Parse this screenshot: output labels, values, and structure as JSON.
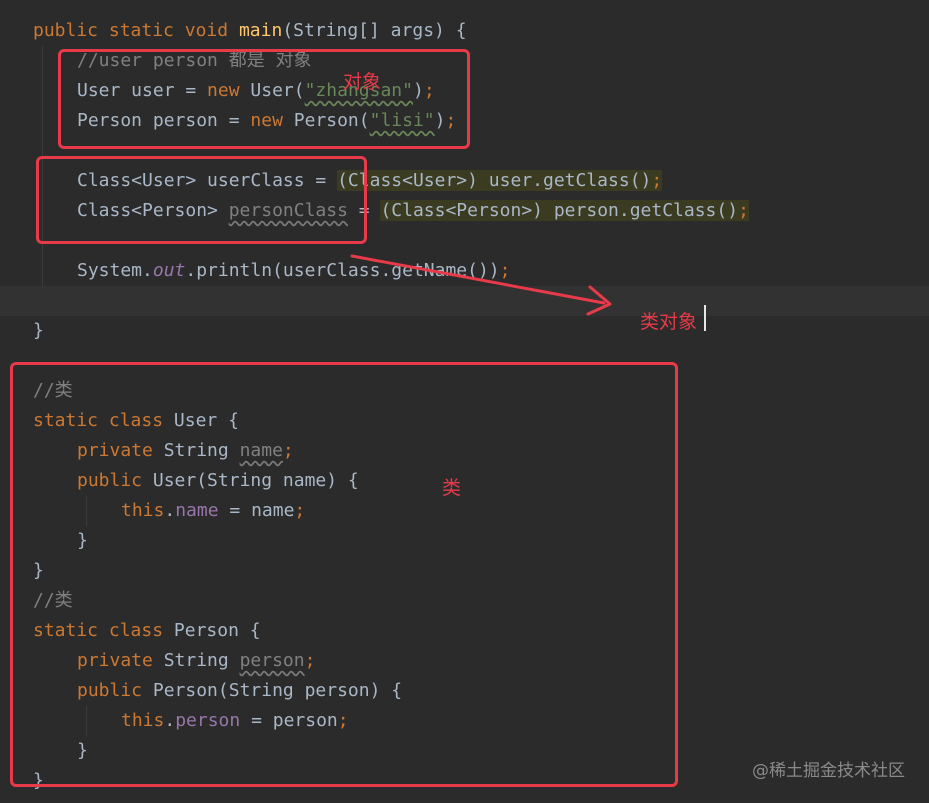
{
  "code": {
    "line1": {
      "mod1": "public",
      "mod2": "static",
      "type": "void",
      "method": "main",
      "rest": "(String[] args) {"
    },
    "line2": {
      "comment": "//user person 都是 对象"
    },
    "line3": {
      "p1": "User user = ",
      "kw": "new",
      "p2": " User(",
      "str": "\"zhangsan\"",
      "p3": ")",
      "semi": ";"
    },
    "line4": {
      "p1": "Person person = ",
      "kw": "new",
      "p2": " Person(",
      "str": "\"lisi\"",
      "p3": ")",
      "semi": ";"
    },
    "line6": {
      "p1": "Class<User> userClass = ",
      "cast": "(Class<User>) user.getClass()",
      "semi": ";"
    },
    "line7": {
      "p1": "Class<Person> ",
      "var": "personClass",
      "p2": " = ",
      "cast": "(Class<Person>) person.getClass()",
      "semi": ";"
    },
    "line9": {
      "p1": "System.",
      "field": "out",
      "p2": ".println(userClass.getName())",
      "semi": ";"
    },
    "line11": {
      "brace": "}"
    },
    "line13": {
      "comment": "//类"
    },
    "line14": {
      "kw1": "static",
      "kw2": "class",
      "rest": " User {"
    },
    "line15": {
      "kw": "private",
      "p1": " String ",
      "field": "name",
      "semi": ";"
    },
    "line16": {
      "kw": "public",
      "p1": " User(String name) {"
    },
    "line17": {
      "kw": "this",
      "p1": ".",
      "field": "name",
      "p2": " = name",
      "semi": ";"
    },
    "line18": {
      "brace": "}"
    },
    "line19": {
      "brace": "}"
    },
    "line20": {
      "comment": "//类"
    },
    "line21": {
      "kw1": "static",
      "kw2": "class",
      "rest": " Person {"
    },
    "line22": {
      "kw": "private",
      "p1": " String ",
      "field": "person",
      "semi": ";"
    },
    "line23": {
      "kw": "public",
      "p1": " Person(String person) {"
    },
    "line24": {
      "kw": "this",
      "p1": ".",
      "field": "person",
      "p2": " = person",
      "semi": ";"
    },
    "line25": {
      "brace": "}"
    },
    "line26": {
      "brace": "}"
    }
  },
  "annotations": {
    "objects": "对象",
    "class_object": "类对象",
    "class": "类"
  },
  "colors": {
    "annotation": "#e83a48",
    "background": "#2b2b2b",
    "keyword": "#cc7832",
    "string": "#6a8759",
    "method": "#ffc66d",
    "field": "#9876aa"
  },
  "watermark": "@稀土掘金技术社区"
}
